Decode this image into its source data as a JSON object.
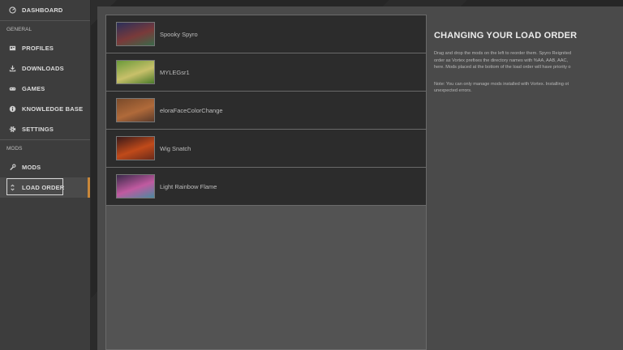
{
  "sidebar": {
    "dashboard": "DASHBOARD",
    "section_general": "GENERAL",
    "general_items": [
      {
        "label": "PROFILES",
        "icon": "profiles-icon"
      },
      {
        "label": "DOWNLOADS",
        "icon": "download-icon"
      },
      {
        "label": "GAMES",
        "icon": "gamepad-icon"
      },
      {
        "label": "KNOWLEDGE BASE",
        "icon": "info-icon"
      },
      {
        "label": "SETTINGS",
        "icon": "gear-icon"
      }
    ],
    "section_mods": "MODS",
    "mods_items": [
      {
        "label": "MODS",
        "icon": "wrench-icon"
      },
      {
        "label": "LOAD ORDER",
        "icon": "load-order-icon"
      }
    ],
    "active": "LOAD ORDER",
    "accent_color": "#c8873a"
  },
  "load_order": {
    "mods": [
      {
        "name": "Spooky Spyro",
        "thumb_colors": [
          "#2a2f5a",
          "#7a3a3a",
          "#3a6a4a"
        ]
      },
      {
        "name": "MYLEGsr1",
        "thumb_colors": [
          "#6a9a3a",
          "#c8c06a",
          "#4a7a2a"
        ]
      },
      {
        "name": "eloraFaceColorChange",
        "thumb_colors": [
          "#7a4a2a",
          "#b06a3a",
          "#5a3a2a"
        ]
      },
      {
        "name": "Wig Snatch",
        "thumb_colors": [
          "#3a1a1a",
          "#c04a1a",
          "#6a2a1a"
        ]
      },
      {
        "name": "Light Rainbow Flame",
        "thumb_colors": [
          "#3a2a4a",
          "#c05aa0",
          "#4a8aa0"
        ]
      }
    ]
  },
  "info": {
    "title": "CHANGING YOUR LOAD ORDER",
    "paragraph1": [
      "Drag and drop the mods on the left to reorder them. Spyro Reignited",
      "order as Vortex prefixes the directory names with %AA, AAB, AAC,",
      "here. Mods placed at the bottom of the load order will have priority o"
    ],
    "paragraph2": [
      "Note: You can only manage mods installed with Vortex. Installing ot",
      "unexpected errors."
    ]
  }
}
